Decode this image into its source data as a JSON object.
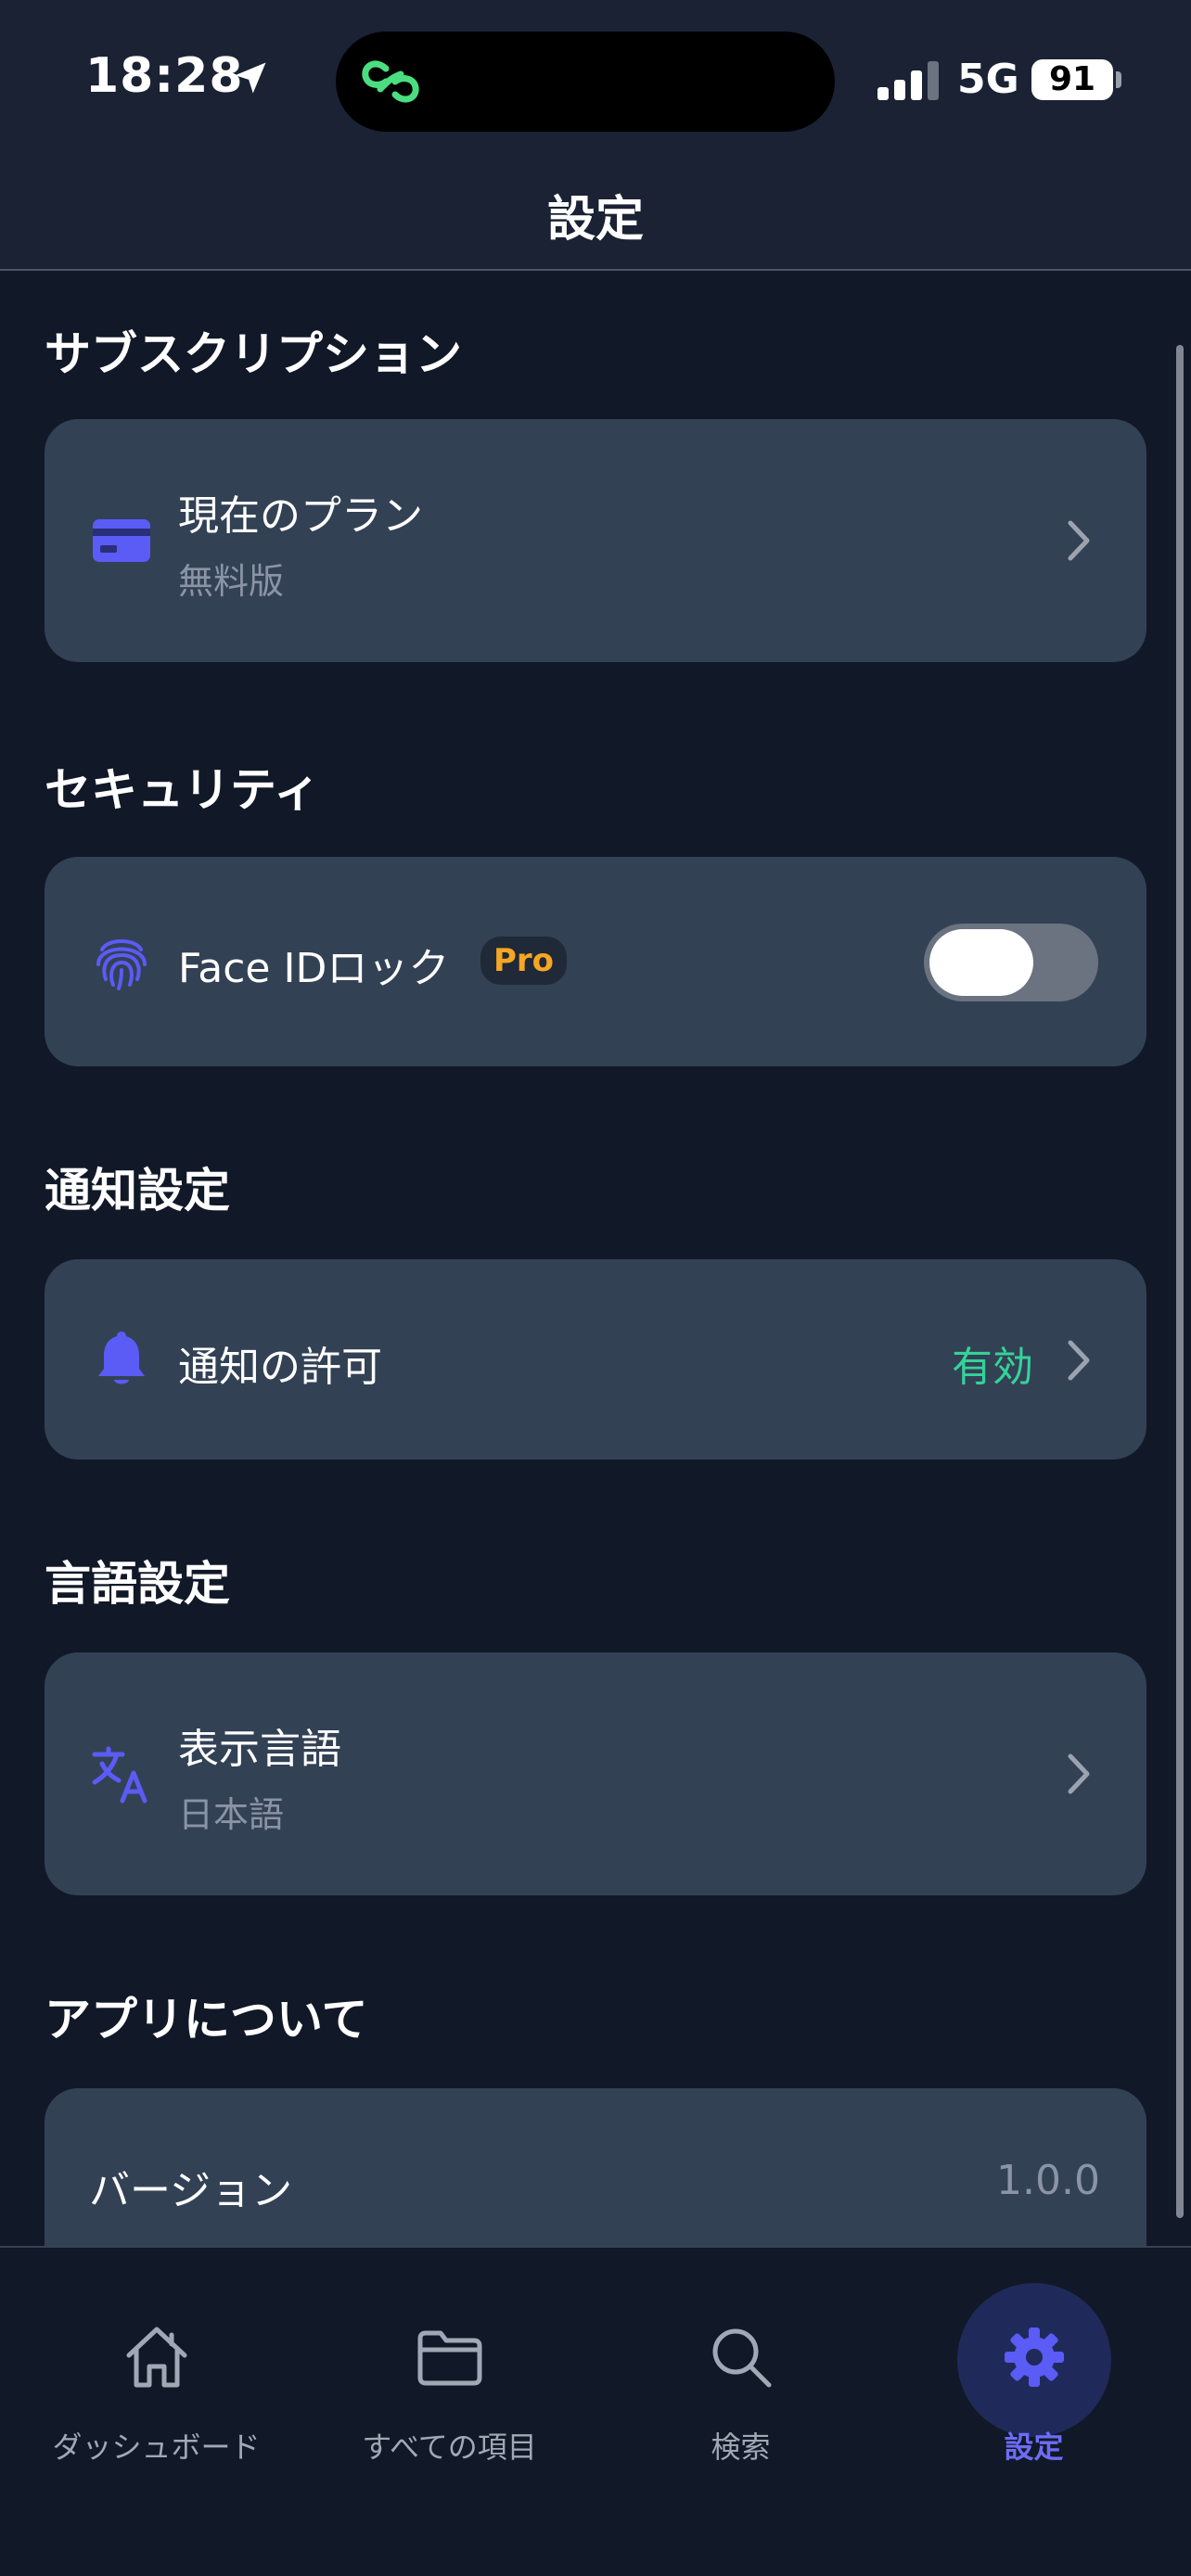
{
  "status_bar": {
    "time": "18:28",
    "network": "5G",
    "battery": "91"
  },
  "header": {
    "title": "設定"
  },
  "sections": {
    "subscription": {
      "title": "サブスクリプション",
      "row_title": "現在のプラン",
      "row_sub": "無料版"
    },
    "security": {
      "title": "セキュリティ",
      "row_title": "Face IDロック",
      "badge": "Pro",
      "toggle_on": false
    },
    "notifications": {
      "title": "通知設定",
      "row_title": "通知の許可",
      "value": "有効"
    },
    "language": {
      "title": "言語設定",
      "row_title": "表示言語",
      "row_sub": "日本語"
    },
    "about": {
      "title": "アプリについて",
      "row_title": "バージョン",
      "value": "1.0.0"
    }
  },
  "tabs": [
    {
      "label": "ダッシュボード",
      "icon": "home-icon"
    },
    {
      "label": "すべての項目",
      "icon": "folder-icon"
    },
    {
      "label": "検索",
      "icon": "search-icon"
    },
    {
      "label": "設定",
      "icon": "gear-icon",
      "active": true
    }
  ],
  "colors": {
    "accent": "#5b5bf5",
    "card": "#334155",
    "background": "#111827",
    "success": "#34d399",
    "pro": "#f5a623"
  }
}
